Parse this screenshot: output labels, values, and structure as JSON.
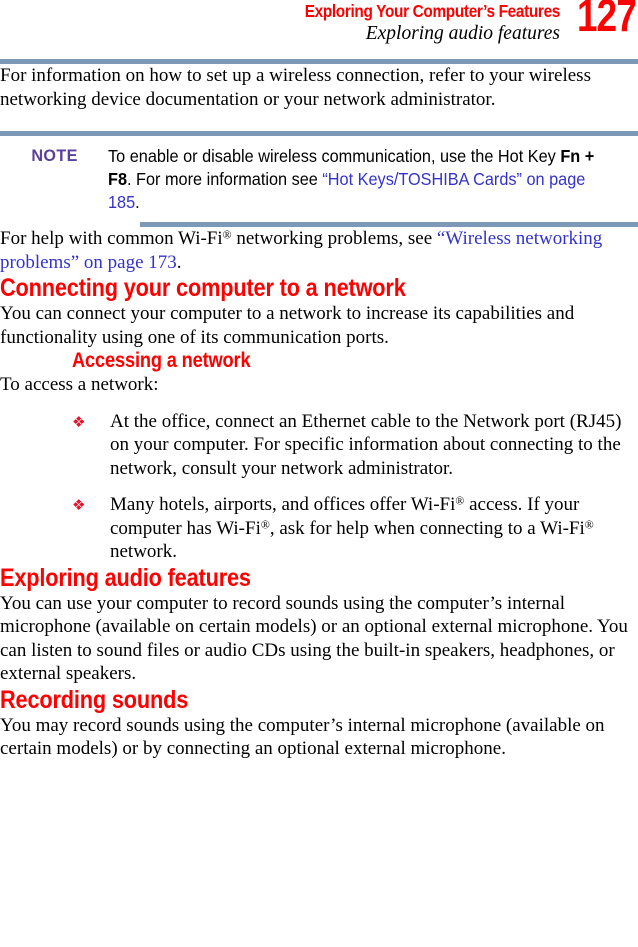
{
  "header": {
    "chapter_title": "Exploring Your Computer’s Features",
    "section_title": "Exploring audio features",
    "page_number": "127"
  },
  "colors": {
    "heading_red": "#ff0000",
    "rule_blue_gray": "#7e99b8",
    "note_label_purple": "#5b3f9d",
    "link_blue": "#3333cc",
    "bullet_red": "#e8112d"
  },
  "intro_paragraph": "For information on how to set up a wireless connection, refer to your wireless networking device documentation or your network administrator.",
  "note": {
    "label": "NOTE",
    "text_part1": "To enable or disable wireless communication, use the Hot Key ",
    "hotkey": "Fn + F8",
    "text_part2": ". For more information see ",
    "link": "“Hot Keys/TOSHIBA Cards” on page 185",
    "text_part3": "."
  },
  "wifi_help": {
    "lead": "For help with common Wi-Fi",
    "reg": "®",
    "middle": " networking problems, see ",
    "link": "“Wireless networking problems” on page 173",
    "tail": "."
  },
  "connecting_section": {
    "heading": "Connecting your computer to a network",
    "paragraph": "You can connect your computer to a network to increase its capabilities and functionality using one of its communication ports.",
    "subheading": "Accessing a network",
    "intro": "To access a network:",
    "bullet_marker": "❖",
    "bullets": [
      {
        "text": "At the office, connect an Ethernet cable to the Network port (RJ45) on your computer. For specific information about connecting to the network, consult your network administrator."
      }
    ],
    "bullet2": {
      "p1": "Many hotels, airports, and offices offer Wi-Fi",
      "p2": " access. If your computer has Wi-Fi",
      "p3": ", ask for help when connecting to a ",
      "p4": "Wi-Fi",
      "p5": " network.",
      "reg": "®"
    }
  },
  "audio_section": {
    "heading": "Exploring audio features",
    "paragraph": "You can use your computer to record sounds using the computer’s internal microphone (available on certain models) or an optional external microphone. You can listen to sound files or audio CDs using the built-in speakers, headphones, or external speakers.",
    "subheading": "Recording sounds",
    "sub_paragraph": "You may record sounds using the computer’s internal microphone (available on certain models) or by connecting an optional external microphone."
  }
}
